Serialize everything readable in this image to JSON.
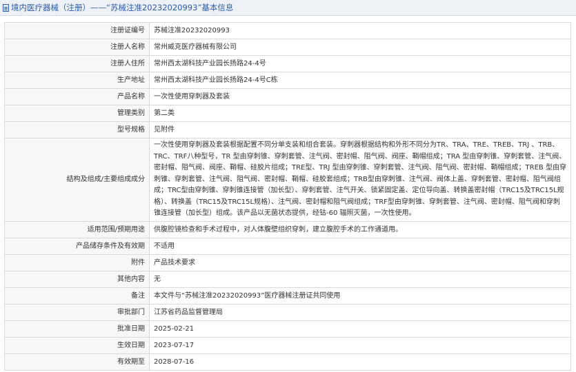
{
  "header": {
    "prefix": "境内医疗器械（注册）",
    "separator": " —— ",
    "title": "“苏械注准20232020993”基本信息"
  },
  "rows": [
    {
      "label": "注册证编号",
      "value": "苏械注准20232020993"
    },
    {
      "label": "注册人名称",
      "value": "常州威克医疗器械有限公司"
    },
    {
      "label": "注册人住所",
      "value": "常州西太湖科技产业园长扬路24-4号"
    },
    {
      "label": "生产地址",
      "value": "常州西太湖科技产业园长扬路24-4号C栋"
    },
    {
      "label": "产品名称",
      "value": "一次性使用穿刺器及套装"
    },
    {
      "label": "管理类别",
      "value": "第二类"
    },
    {
      "label": "型号规格",
      "value": "见附件"
    },
    {
      "label": "结构及组成/主要组成成分",
      "value": "一次性使用穿刺器及套装根据配置不同分单支装和组合套装。穿刺器根据结构和外形不同分为TR、TRA、TRE、TREB、TRJ 、TRB、TRC、TRF八种型号，TR 型由穿刺锥、穿刺套管、注气阀、密封帽、阻气阀、阀座、鞘帽组成；TRA 型由穿刺锥、穿刺套管、注气阀、密封帽、阻气阀、阀座、鞘帽、硅胶片组成；TRE型、TRJ 型由穿刺锥、穿刺套管、注气阀、阻气阀、密封帽、鞘帽组成；TREB 型由穿刺锥、穿刺套管、注气阀、阻气阀、密封帽、鞘帽、硅胶套组成；TRB型由穿刺锥、注气阀、阀体上盖、穿刺套管、密封帽、阻气阀组成；TRC型由穿刺锥、穿刺锥连接管（加长型）、穿刺套管、注气开关、锁紧固定盖、定位导向盖、转换盖密封帽（TRC15及TRC15L规格）、转换盖（TRC15及TRC15L规格）、注气阀、密封帽和阻气阀组成；TRF型由穿刺锥、穿刺套管、注气阀、密封帽、阻气阀和穿刺锥连接管（加长型）组成。该产品以无菌状态提供，经钴-60 辐照灭菌，一次性使用。"
    },
    {
      "label": "适用范围/预期用途",
      "value": "供腹腔镜检查和手术过程中，对人体腹壁组织穿刺，建立腹腔手术的工作通道用。"
    },
    {
      "label": "产品储存条件及有效期",
      "value": "不适用"
    },
    {
      "label": "附件",
      "value": "产品技术要求"
    },
    {
      "label": "其他内容",
      "value": "无"
    },
    {
      "label": "备注",
      "value": "本文件与“苏械注准20232020993”医疗器械注册证共同使用"
    },
    {
      "label": "审批部门",
      "value": "江苏省药品监督管理局"
    },
    {
      "label": "批准日期",
      "value": "2025-02-21"
    },
    {
      "label": "生效日期",
      "value": "2023-07-17"
    },
    {
      "label": "有效期至",
      "value": "2028-07-16"
    }
  ]
}
